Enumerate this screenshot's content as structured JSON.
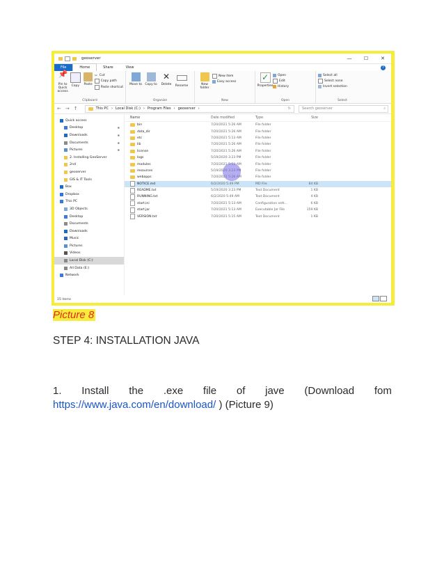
{
  "screenshot": {
    "title": "geoserver",
    "tabs": [
      "File",
      "Home",
      "Share",
      "View"
    ],
    "help": "?",
    "window_controls": [
      "—",
      "☐",
      "✕"
    ],
    "ribbon": {
      "clipboard": {
        "label": "Clipboard",
        "pin": "Pin to Quick access",
        "copy": "Copy",
        "paste": "Paste",
        "cut": "Cut",
        "copy_path": "Copy path",
        "paste_shortcut": "Paste shortcut"
      },
      "organize": {
        "label": "Organize",
        "move_to": "Move to",
        "copy_to": "Copy to",
        "delete": "Delete",
        "rename": "Rename"
      },
      "new": {
        "label": "New",
        "new_folder": "New folder",
        "new_item": "New item",
        "easy_access": "Easy access"
      },
      "open": {
        "label": "Open",
        "properties": "Properties",
        "open": "Open",
        "edit": "Edit",
        "history": "History"
      },
      "select": {
        "label": "Select",
        "select_all": "Select all",
        "select_none": "Select none",
        "invert": "Invert selection"
      }
    },
    "breadcrumb": [
      "This PC",
      "Local Disk (C:)",
      "Program Files",
      "geoserver"
    ],
    "search_placeholder": "Search geoserver",
    "nav": [
      {
        "label": "Quick access",
        "level": 1,
        "pin": false
      },
      {
        "label": "Desktop",
        "level": 2,
        "pin": true
      },
      {
        "label": "Downloads",
        "level": 2,
        "pin": true
      },
      {
        "label": "Documents",
        "level": 2,
        "pin": true
      },
      {
        "label": "Pictures",
        "level": 2,
        "pin": true
      },
      {
        "label": "2. Installing GeoServer",
        "level": 2,
        "pin": false
      },
      {
        "label": "2nd",
        "level": 2,
        "pin": false
      },
      {
        "label": "geoserver",
        "level": 2,
        "pin": false
      },
      {
        "label": "GIS & IT Tools",
        "level": 2,
        "pin": false
      },
      {
        "label": "Box",
        "level": 1,
        "pin": false
      },
      {
        "label": "Dropbox",
        "level": 1,
        "pin": false
      },
      {
        "label": "This PC",
        "level": 1,
        "pin": false
      },
      {
        "label": "3D Objects",
        "level": 2,
        "pin": false
      },
      {
        "label": "Desktop",
        "level": 2,
        "pin": false
      },
      {
        "label": "Documents",
        "level": 2,
        "pin": false
      },
      {
        "label": "Downloads",
        "level": 2,
        "pin": false
      },
      {
        "label": "Music",
        "level": 2,
        "pin": false
      },
      {
        "label": "Pictures",
        "level": 2,
        "pin": false
      },
      {
        "label": "Videos",
        "level": 2,
        "pin": false
      },
      {
        "label": "Local Disk (C:)",
        "level": 2,
        "pin": false,
        "selected": true
      },
      {
        "label": "All Data (E:)",
        "level": 2,
        "pin": false
      },
      {
        "label": "Network",
        "level": 1,
        "pin": false
      }
    ],
    "columns": {
      "name": "Name",
      "date": "Date modified",
      "type": "Type",
      "size": "Size"
    },
    "files": [
      {
        "name": "bin",
        "date": "7/20/2021 5:26 AM",
        "type": "File folder",
        "size": "",
        "kind": "folder"
      },
      {
        "name": "data_dir",
        "date": "7/20/2021 5:26 AM",
        "type": "File folder",
        "size": "",
        "kind": "folder"
      },
      {
        "name": "etc",
        "date": "7/20/2021 5:13 AM",
        "type": "File folder",
        "size": "",
        "kind": "folder"
      },
      {
        "name": "lib",
        "date": "7/20/2021 5:26 AM",
        "type": "File folder",
        "size": "",
        "kind": "folder"
      },
      {
        "name": "license",
        "date": "7/20/2021 5:26 AM",
        "type": "File folder",
        "size": "",
        "kind": "folder"
      },
      {
        "name": "logs",
        "date": "5/19/2020 3:23 PM",
        "type": "File folder",
        "size": "",
        "kind": "folder"
      },
      {
        "name": "modules",
        "date": "7/20/2021 5:13 AM",
        "type": "File folder",
        "size": "",
        "kind": "folder"
      },
      {
        "name": "resources",
        "date": "5/19/2020 3:23 PM",
        "type": "File folder",
        "size": "",
        "kind": "folder"
      },
      {
        "name": "webapps",
        "date": "7/20/2021 5:26 AM",
        "type": "File folder",
        "size": "",
        "kind": "folder"
      },
      {
        "name": "NOTICE.md",
        "date": "6/2/2020 5:49 PM",
        "type": "MD File",
        "size": "84 KB",
        "kind": "file",
        "highlight": true
      },
      {
        "name": "README.txt",
        "date": "5/19/2020 3:23 PM",
        "type": "Text Document",
        "size": "1 KB",
        "kind": "file"
      },
      {
        "name": "RUNNING.txt",
        "date": "6/2/2020 5:49 AM",
        "type": "Text Document",
        "size": "4 KB",
        "kind": "file"
      },
      {
        "name": "start.ini",
        "date": "7/20/2021 5:13 AM",
        "type": "Configuration sett...",
        "size": "6 KB",
        "kind": "file"
      },
      {
        "name": "start.jar",
        "date": "7/20/2021 5:13 AM",
        "type": "Executable Jar File",
        "size": "159 KB",
        "kind": "file"
      },
      {
        "name": "VERSION.txt",
        "date": "7/20/2021 5:15 AM",
        "type": "Text Document",
        "size": "1 KB",
        "kind": "file"
      }
    ],
    "status": "15 items"
  },
  "caption": "Picture 8",
  "step_heading": "STEP 4: INSTALLATION JAVA",
  "paragraph": {
    "words": [
      "1.",
      "Install",
      "the",
      ".exe",
      "file",
      "of",
      "jave",
      "(Download",
      "fom"
    ],
    "link": "https://www.java.com/en/download/",
    "after_link": " ) (Picture 9)"
  },
  "colors": {
    "highlight": "#f6ec3a",
    "caption_text": "#e8261e",
    "link": "#1a55c5",
    "file_tab": "#1a6cc8"
  }
}
